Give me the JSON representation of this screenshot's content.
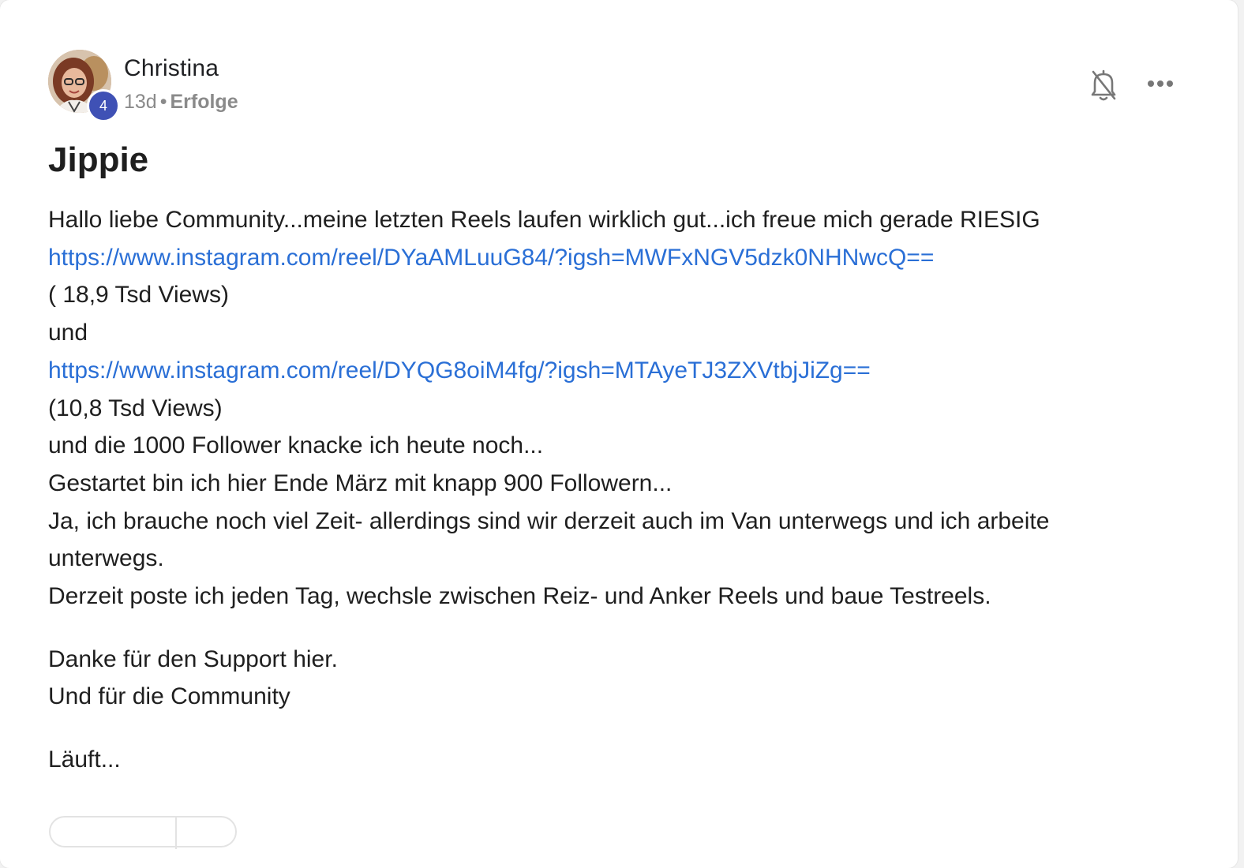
{
  "post": {
    "author": {
      "name": "Christina",
      "level": "4"
    },
    "age": "13d",
    "separator": "•",
    "category": "Erfolge",
    "title": "Jippie",
    "body": {
      "line1": "Hallo liebe Community...meine letzten Reels laufen wirklich gut...ich freue mich gerade RIESIG",
      "link1": "https://www.instagram.com/reel/DYaAMLuuG84/?igsh=MWFxNGV5dzk0NHNwcQ==",
      "views1": "( 18,9 Tsd Views)",
      "and": "und",
      "link2": "https://www.instagram.com/reel/DYQG8oiM4fg/?igsh=MTAyeTJ3ZXVtbjJiZg==",
      "views2": "(10,8 Tsd Views)",
      "line_followers": "und die 1000 Follower knacke ich heute noch...",
      "line_start": "Gestartet bin ich hier Ende März mit knapp 900 Followern...",
      "line_time": "Ja, ich brauche noch viel Zeit- allerdings sind wir derzeit auch im Van unterwegs und ich arbeite unterwegs.",
      "line_posting": "Derzeit poste ich jeden Tag, wechsle zwischen Reiz- und Anker Reels und baue Testreels.",
      "thanks1": "Danke für den Support hier.",
      "thanks2": "Und für die Community",
      "closing": "Läuft..."
    }
  },
  "icons": {
    "notifications": "bell-off-icon",
    "menu": "more-horizontal-icon"
  },
  "colors": {
    "link": "#2a6fd6",
    "level_badge": "#3f51b5",
    "meta_text": "#8a8a8a"
  }
}
